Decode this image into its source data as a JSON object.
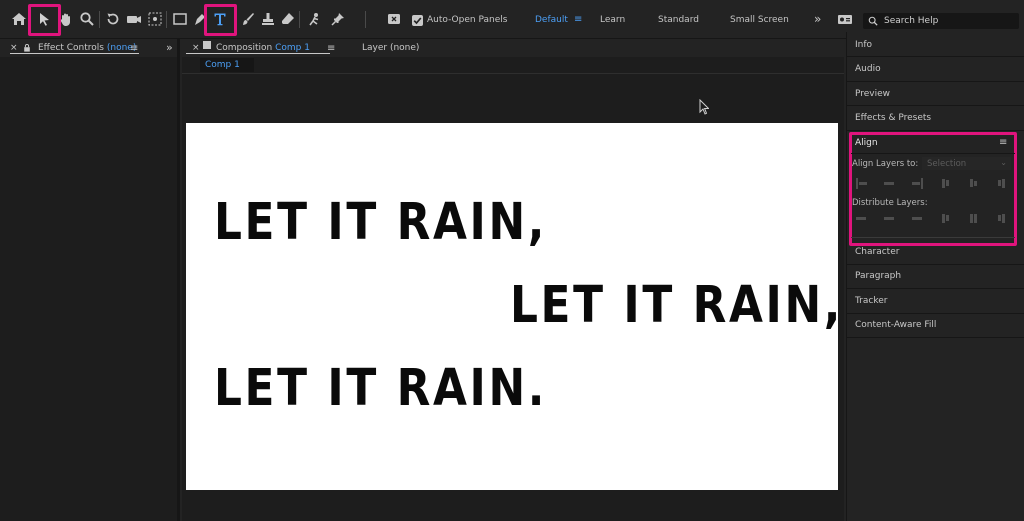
{
  "toolbar": {
    "checkbox_label": "Auto-Open Panels",
    "workspaces": [
      "Default",
      "Learn",
      "Standard",
      "Small Screen"
    ],
    "overflow": "»",
    "search_placeholder": "Search Help"
  },
  "left_panel": {
    "close": "×",
    "title": "Effect Controls",
    "title_value": "(none)",
    "menu": "≡",
    "collapse": "»"
  },
  "comp_panel": {
    "close": "×",
    "title": "Composition",
    "comp_name": "Comp 1",
    "menu": "≡",
    "layer_tab": "Layer (none)",
    "sub_tab": "Comp 1",
    "lines": [
      "LET IT RAIN,",
      "LET IT RAIN,",
      "LET IT RAIN."
    ]
  },
  "right_panel": {
    "items_top": [
      "Info",
      "Audio",
      "Preview",
      "Effects & Presets"
    ],
    "align_title": "Align",
    "align_menu": "≡",
    "align_to_label": "Align Layers to:",
    "align_to_value": "Selection",
    "distribute_label": "Distribute Layers:",
    "items_bottom": [
      "Character",
      "Paragraph",
      "Tracker",
      "Content-Aware Fill"
    ]
  },
  "colors": {
    "accent": "#4c9ff5",
    "highlight": "#e0147d",
    "canvas": "#ffffff"
  }
}
